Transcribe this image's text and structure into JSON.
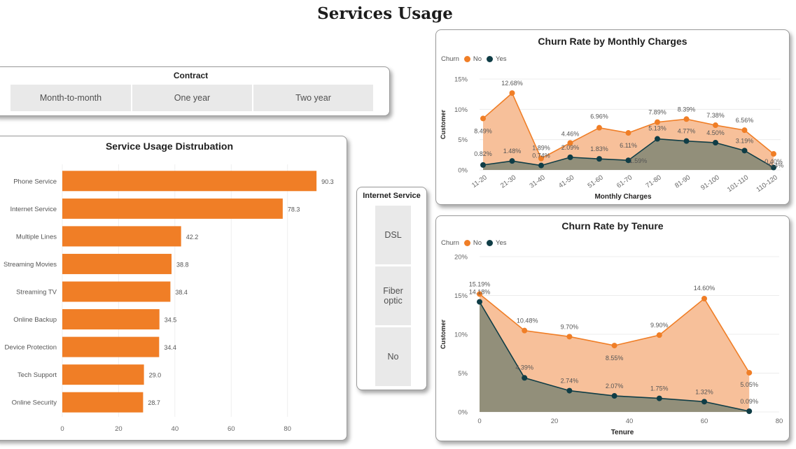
{
  "page": {
    "title": "Services Usage"
  },
  "contract_slicer": {
    "title": "Contract",
    "options": [
      "Month-to-month",
      "One year",
      "Two year"
    ]
  },
  "internet_slicer": {
    "title": "Internet Service",
    "options": [
      "DSL",
      "Fiber optic",
      "No"
    ]
  },
  "colors": {
    "no": "#f07e26",
    "yes": "#0f3d46",
    "bar": "#f07e26"
  },
  "legend": {
    "title": "Churn",
    "no": "No",
    "yes": "Yes"
  },
  "chart_data": [
    {
      "id": "service_usage",
      "type": "bar",
      "orientation": "horizontal",
      "title": "Service Usage Distrubation",
      "categories": [
        "Phone Service",
        "Internet Service",
        "Multiple Lines",
        "Streaming Movies",
        "Streaming TV",
        "Online Backup",
        "Device Protection",
        "Tech Support",
        "Online Security"
      ],
      "values": [
        90.3,
        78.3,
        42.2,
        38.8,
        38.4,
        34.5,
        34.4,
        29.0,
        28.7
      ],
      "value_labels": [
        "90.3",
        "78.3",
        "42.2",
        "38.8",
        "38.4",
        "34.5",
        "34.4",
        "29.0",
        "28.7"
      ],
      "xticks": [
        "0",
        "20",
        "40",
        "60",
        "80"
      ],
      "xlim": [
        0,
        95
      ],
      "grid": true
    },
    {
      "id": "churn_monthly",
      "type": "area",
      "title": "Churn Rate by Monthly Charges",
      "xlabel": "Monthly Charges",
      "ylabel": "Customer",
      "categories": [
        "11-20",
        "21-30",
        "31-40",
        "41-50",
        "51-60",
        "61-70",
        "71-80",
        "81-90",
        "91-100",
        "101-110",
        "110-120"
      ],
      "series": [
        {
          "name": "No",
          "values": [
            8.49,
            12.68,
            1.89,
            4.46,
            6.96,
            6.11,
            7.89,
            8.39,
            7.38,
            6.56,
            2.65
          ],
          "labels": [
            "8.49%",
            "12.68%",
            "1.89%",
            "4.46%",
            "6.96%",
            "6.11%",
            "7.89%",
            "8.39%",
            "7.38%",
            "6.56%",
            "0.40%"
          ]
        },
        {
          "name": "Yes",
          "values": [
            0.82,
            1.48,
            0.74,
            2.09,
            1.83,
            1.59,
            5.13,
            4.77,
            4.5,
            3.19,
            0.4
          ],
          "labels": [
            "0.82%",
            "1.48%",
            "0.74%",
            "2.09%",
            "1.83%",
            "1.59%",
            "5.13%",
            "4.77%",
            "4.50%",
            "3.19%",
            "0.4%"
          ]
        }
      ],
      "yticks": [
        "0%",
        "5%",
        "10%",
        "15%"
      ],
      "ylim": [
        0,
        15
      ],
      "legend_position": "top-left"
    },
    {
      "id": "churn_tenure",
      "type": "area",
      "title": "Churn Rate by Tenure",
      "xlabel": "Tenure",
      "ylabel": "Customer",
      "x": [
        0,
        12,
        24,
        36,
        48,
        60,
        72
      ],
      "series": [
        {
          "name": "No",
          "values": [
            15.19,
            10.48,
            9.7,
            8.55,
            9.9,
            14.6,
            5.05
          ],
          "labels": [
            "15.19%",
            "10.48%",
            "9.70%",
            "8.55%",
            "9.90%",
            "14.60%",
            "5.05%"
          ]
        },
        {
          "name": "Yes",
          "values": [
            14.18,
            4.39,
            2.74,
            2.07,
            1.75,
            1.32,
            0.09
          ],
          "labels": [
            "14.18%",
            "4.39%",
            "2.74%",
            "2.07%",
            "1.75%",
            "1.32%",
            "0.09%"
          ]
        }
      ],
      "xticks": [
        "0",
        "20",
        "40",
        "60",
        "80"
      ],
      "xlim": [
        0,
        80
      ],
      "yticks": [
        "0%",
        "5%",
        "10%",
        "15%",
        "20%"
      ],
      "ylim": [
        0,
        20
      ],
      "legend_position": "top-left"
    }
  ]
}
